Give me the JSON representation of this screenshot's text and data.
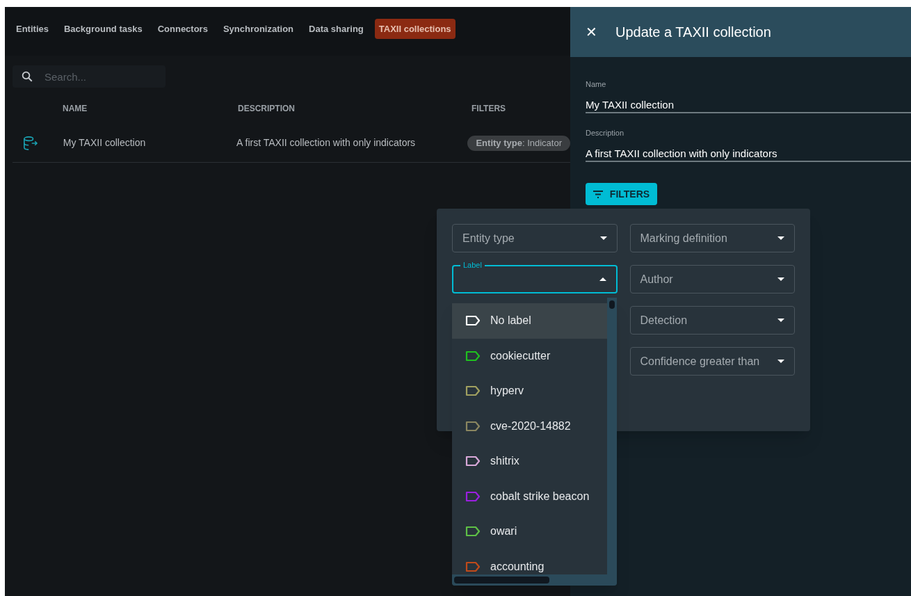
{
  "nav_tabs": [
    {
      "label": "Entities",
      "selected": false
    },
    {
      "label": "Background tasks",
      "selected": false
    },
    {
      "label": "Connectors",
      "selected": false
    },
    {
      "label": "Synchronization",
      "selected": false
    },
    {
      "label": "Data sharing",
      "selected": false
    },
    {
      "label": "TAXII collections",
      "selected": true
    }
  ],
  "search": {
    "placeholder": "Search..."
  },
  "table": {
    "columns": [
      "NAME",
      "DESCRIPTION",
      "FILTERS"
    ],
    "rows": [
      {
        "name": "My TAXII collection",
        "description": "A first TAXII collection with only indicators",
        "filters": "**Entity type**: Indicator"
      }
    ]
  },
  "drawer": {
    "close": "✕",
    "title": "Update a TAXII collection",
    "fields": [
      {
        "label": "Name",
        "value": "My TAXII collection"
      },
      {
        "label": "Description",
        "value": "A first TAXII collection with only indicators"
      }
    ],
    "filters_button": "FILTERS"
  },
  "filter_panel": {
    "left": [
      {
        "label": "Entity type",
        "open": false
      },
      {
        "label": "Label",
        "open": true
      }
    ],
    "right": [
      {
        "label": "Marking definition",
        "open": false
      },
      {
        "label": "Author",
        "open": false
      },
      {
        "label": "Detection",
        "open": false
      },
      {
        "label": "Confidence greater than",
        "open": false
      }
    ]
  },
  "label_options": [
    {
      "label": "No label",
      "color": "#ffffff",
      "selected": true
    },
    {
      "label": "cookiecutter",
      "color": "#1fc01f",
      "selected": false
    },
    {
      "label": "hyperv",
      "color": "#a0a060",
      "selected": false
    },
    {
      "label": "cve-2020-14882",
      "color": "#8a8660",
      "selected": false
    },
    {
      "label": "shitrix",
      "color": "#d8a8d8",
      "selected": false
    },
    {
      "label": "cobalt strike beacon",
      "color": "#9b1fe0",
      "selected": false
    },
    {
      "label": "owari",
      "color": "#5ec046",
      "selected": false
    },
    {
      "label": "accounting",
      "color": "#c04a1a",
      "selected": false
    }
  ]
}
